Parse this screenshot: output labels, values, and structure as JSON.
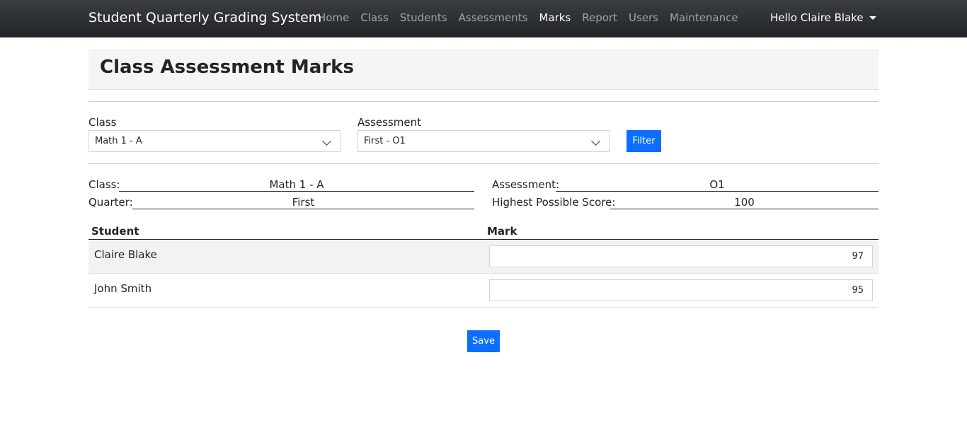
{
  "navbar": {
    "brand": "Student Quarterly Grading System",
    "links": [
      {
        "label": "Home",
        "active": false
      },
      {
        "label": "Class",
        "active": false
      },
      {
        "label": "Students",
        "active": false
      },
      {
        "label": "Assessments",
        "active": false
      },
      {
        "label": "Marks",
        "active": true
      },
      {
        "label": "Report",
        "active": false
      },
      {
        "label": "Users",
        "active": false
      },
      {
        "label": "Maintenance",
        "active": false
      }
    ],
    "user_greeting": "Hello Claire Blake"
  },
  "page": {
    "title": "Class Assessment Marks"
  },
  "filter": {
    "class_label": "Class",
    "class_selected": "Math 1 - A",
    "assessment_label": "Assessment",
    "assessment_selected": "First - O1",
    "filter_button": "Filter"
  },
  "info": {
    "class_label": "Class:",
    "class_value": "Math 1 - A",
    "quarter_label": "Quarter:",
    "quarter_value": "First",
    "assessment_label": "Assessment:",
    "assessment_value": "O1",
    "hps_label": "Highest Possible Score:",
    "hps_value": "100"
  },
  "table": {
    "headers": [
      "Student",
      "Mark"
    ],
    "rows": [
      {
        "student": "Claire Blake",
        "mark": "97"
      },
      {
        "student": "John Smith",
        "mark": "95"
      }
    ]
  },
  "actions": {
    "save_label": "Save"
  },
  "colors": {
    "primary": "#0d6efd",
    "navbar": "#212529"
  }
}
